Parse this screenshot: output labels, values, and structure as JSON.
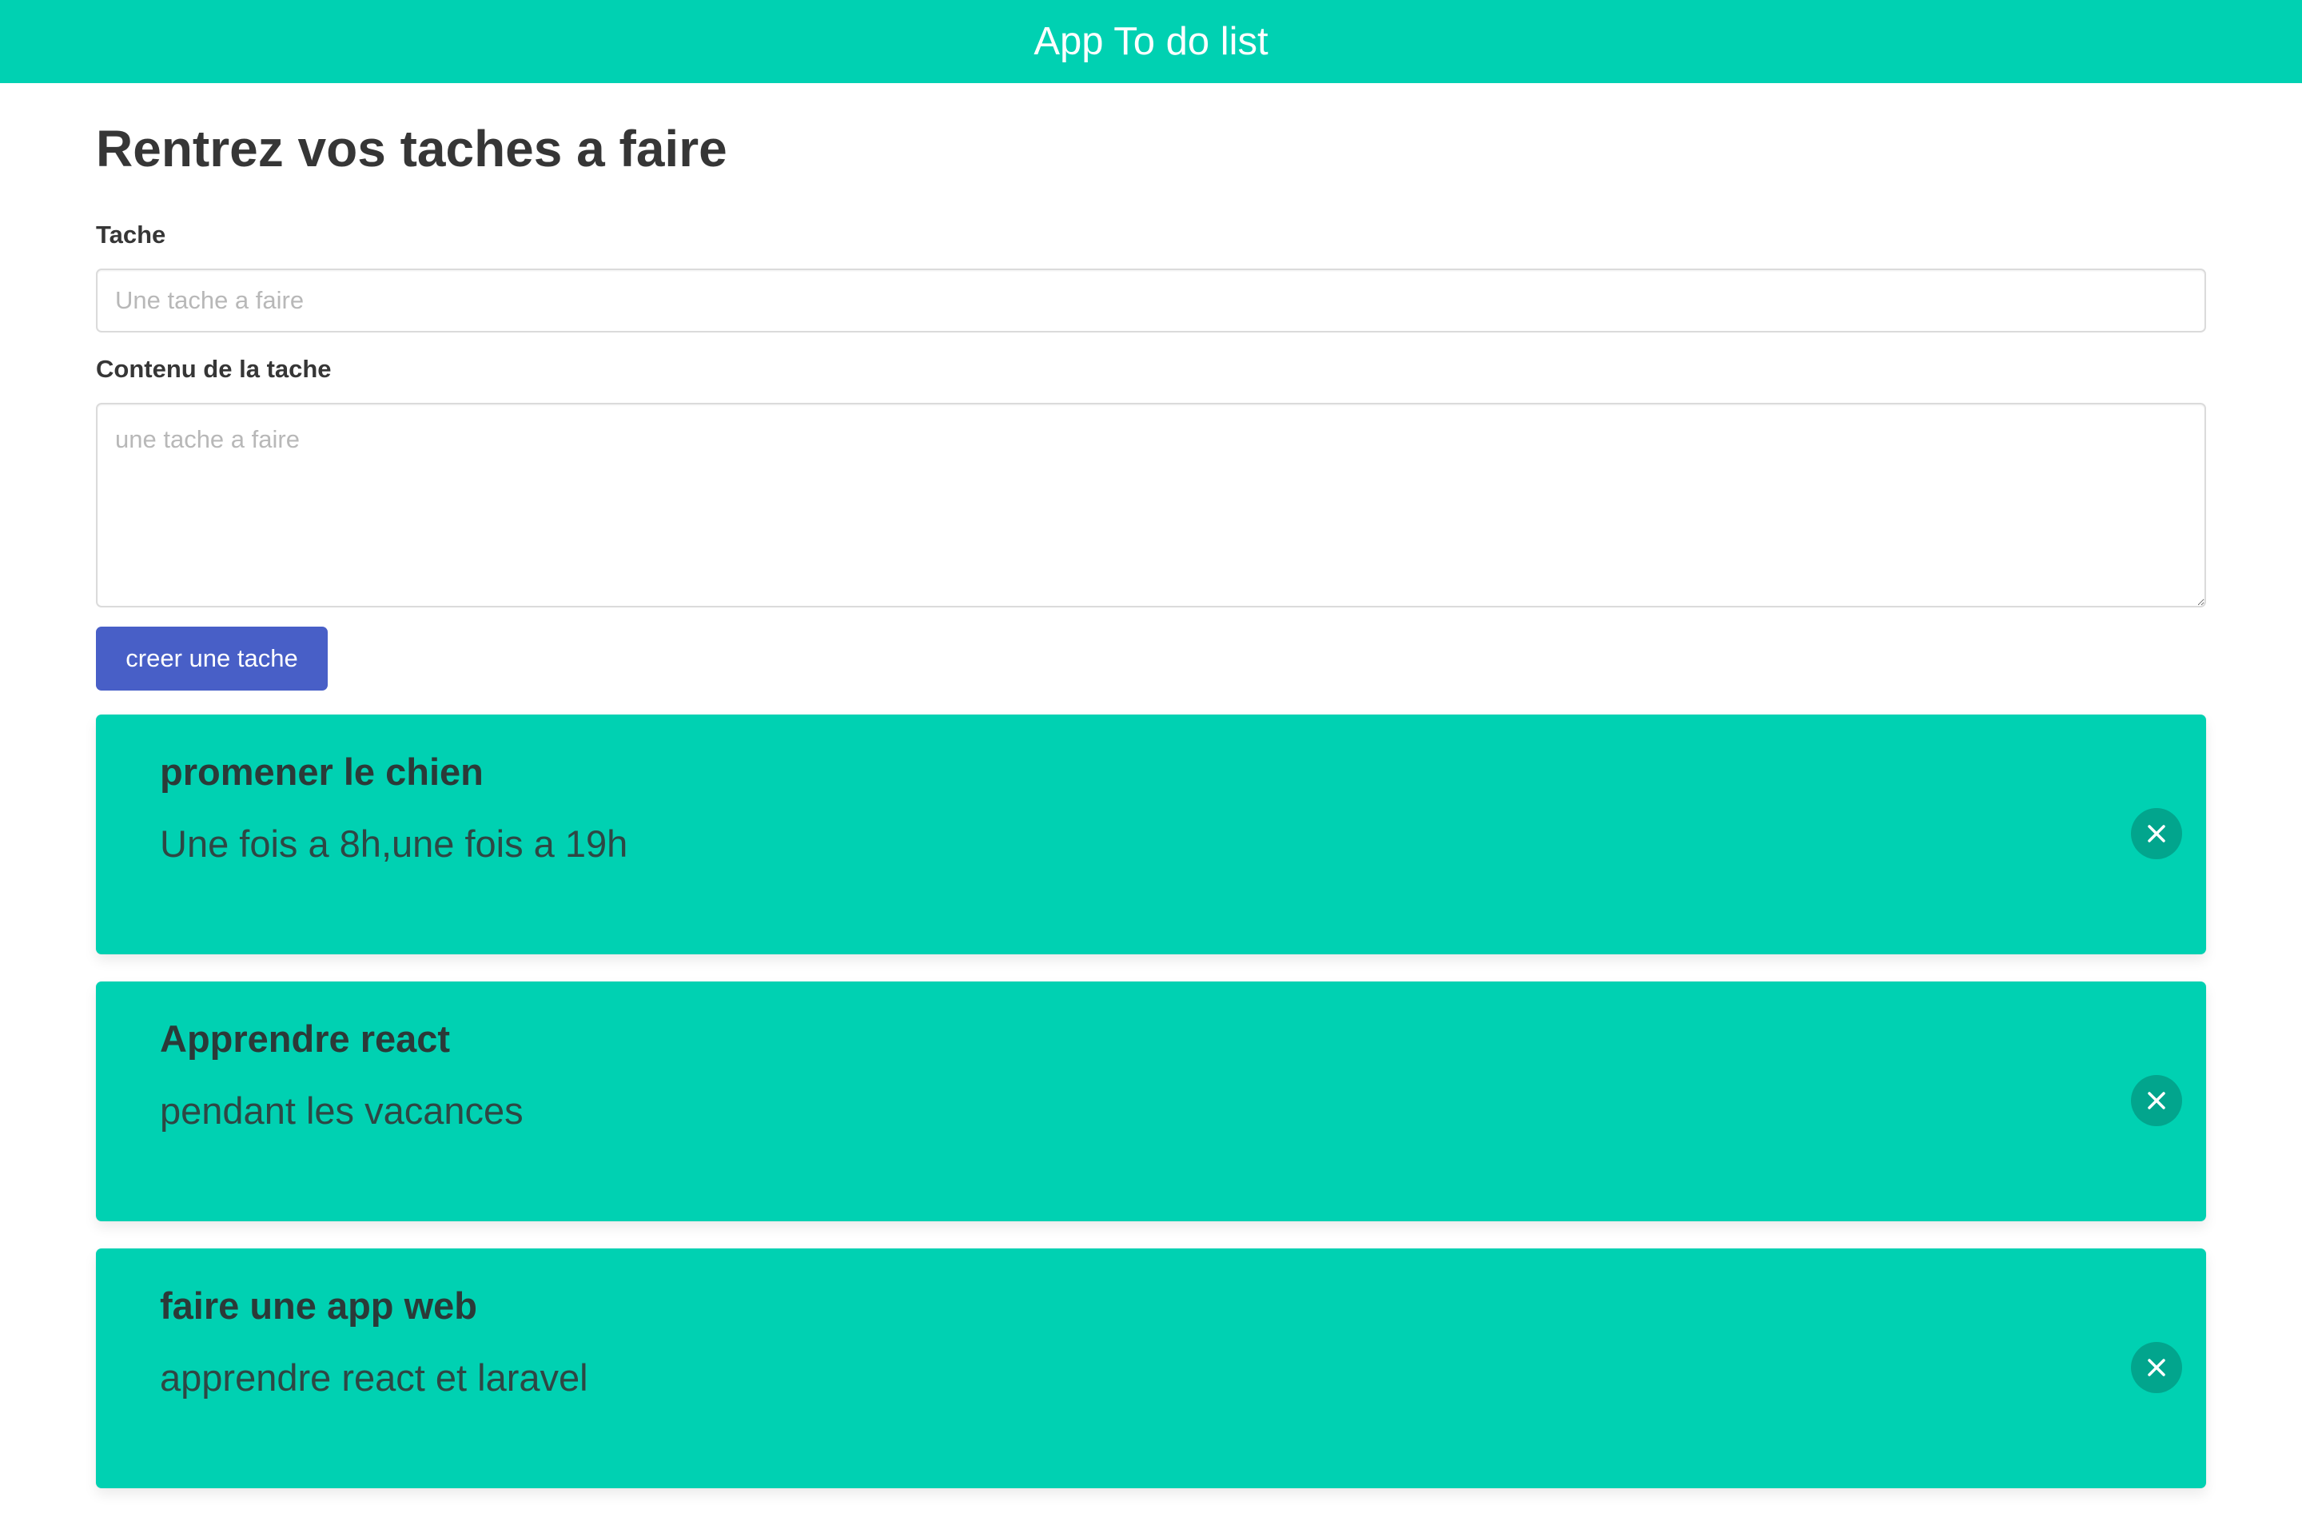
{
  "app": {
    "title": "App To do list"
  },
  "form": {
    "heading": "Rentrez vos taches a faire",
    "task_label": "Tache",
    "task_placeholder": "Une tache a faire",
    "task_value": "",
    "content_label": "Contenu de la tache",
    "content_placeholder": "une tache a faire",
    "content_value": "",
    "submit_label": "creer une tache"
  },
  "tasks": [
    {
      "title": "promener le chien",
      "content": "Une fois a 8h,une fois a 19h",
      "delete_icon": "close-icon"
    },
    {
      "title": "Apprendre react",
      "content": "pendant les vacances",
      "delete_icon": "close-icon"
    },
    {
      "title": "faire une app web",
      "content": "apprendre react et laravel",
      "delete_icon": "close-icon"
    }
  ],
  "colors": {
    "primary": "#00d1b2",
    "button": "#485fc7",
    "text": "#363636"
  }
}
